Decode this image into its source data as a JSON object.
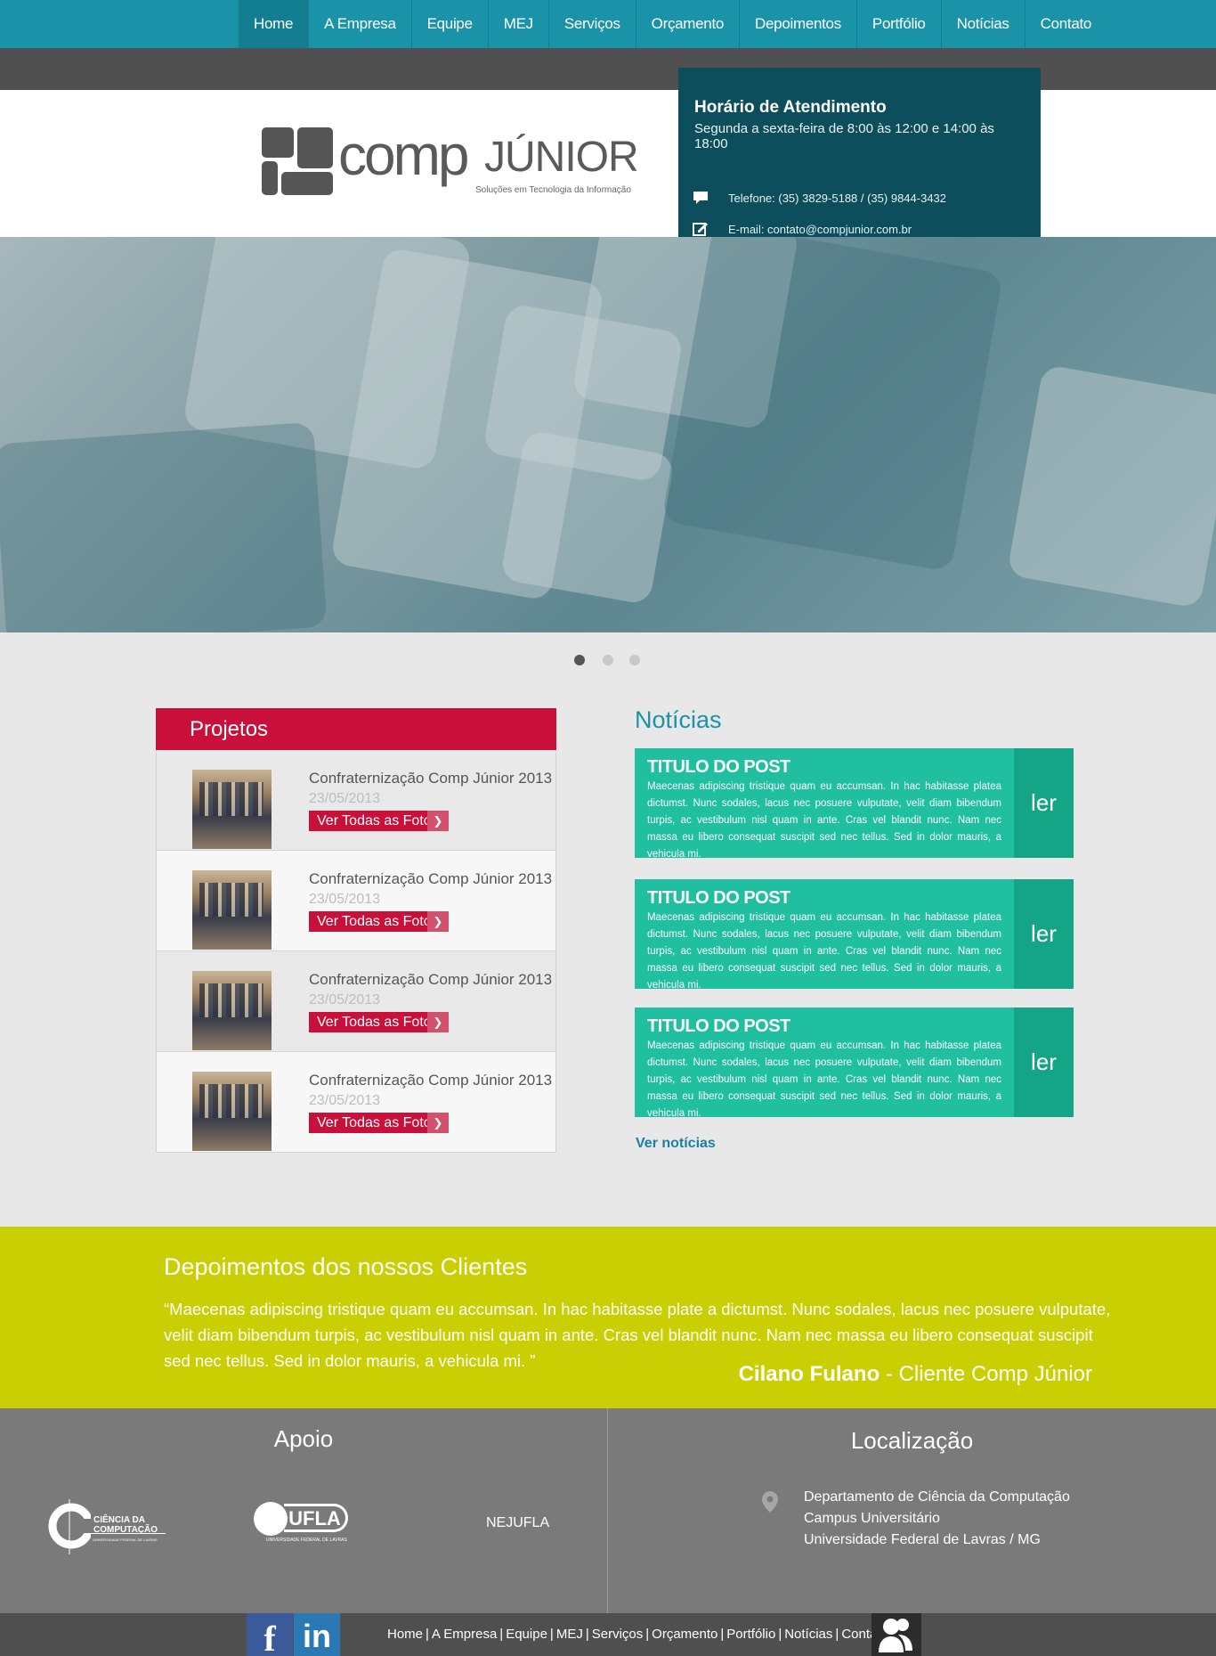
{
  "nav": {
    "items": [
      "Home",
      "A Empresa",
      "Equipe",
      "MEJ",
      "Serviços",
      "Orçamento",
      "Depoimentos",
      "Portfólio",
      "Notícias",
      "Contato"
    ],
    "active": "Home"
  },
  "logo": {
    "word": "comp",
    "word2": "JÚNIOR",
    "tagline": "Soluções em Tecnologia da Informação"
  },
  "info": {
    "title": "Horário de Atendimento",
    "hours": "Segunda a sexta-feira de 8:00 às 12:00 e 14:00 às 18:00",
    "phone": "Telefone: (35) 3829-5188 / (35) 9844-3432",
    "email": "E-mail: contato@compjunior.com.br"
  },
  "slider": {
    "count": 3,
    "active": 1
  },
  "projetos": {
    "title": "Projetos",
    "items": [
      {
        "title": "Confraternização Comp Júnior 2013",
        "date": "23/05/2013",
        "button": "Ver Todas as Fotos"
      },
      {
        "title": "Confraternização Comp Júnior 2013",
        "date": "23/05/2013",
        "button": "Ver Todas as Fotos"
      },
      {
        "title": "Confraternização Comp Júnior 2013",
        "date": "23/05/2013",
        "button": "Ver Todas as Fotos"
      },
      {
        "title": "Confraternização Comp Júnior 2013",
        "date": "23/05/2013",
        "button": "Ver Todas as Fotos"
      }
    ]
  },
  "noticias": {
    "title": "Notícias",
    "posts": [
      {
        "title": "TITULO DO POST",
        "text": "Maecenas adipiscing tristique quam eu accumsan. In hac habitasse platea dictumst. Nunc sodales, lacus nec posuere vulputate, velit diam bibendum turpis, ac vestibulum nisl quam in ante. Cras vel blandit nunc. Nam nec massa eu libero consequat suscipit sed nec tellus. Sed in dolor mauris, a vehicula mi.",
        "read": "ler"
      },
      {
        "title": "TITULO DO POST",
        "text": "Maecenas adipiscing tristique quam eu accumsan. In hac habitasse platea dictumst. Nunc sodales, lacus nec posuere vulputate, velit diam bibendum turpis, ac vestibulum nisl quam in ante. Cras vel blandit nunc. Nam nec massa eu libero consequat suscipit sed nec tellus. Sed in dolor mauris, a vehicula mi.",
        "read": "ler"
      },
      {
        "title": "TITULO DO POST",
        "text": "Maecenas adipiscing tristique quam eu accumsan. In hac habitasse platea dictumst. Nunc sodales, lacus nec posuere vulputate, velit diam bibendum turpis, ac vestibulum nisl quam in ante. Cras vel blandit nunc. Nam nec massa eu libero consequat suscipit sed nec tellus. Sed in dolor mauris, a vehicula mi.",
        "read": "ler"
      }
    ],
    "more": "Ver notícias"
  },
  "depoimentos": {
    "title": "Depoimentos dos nossos Clientes",
    "quote": "“Maecenas adipiscing tristique quam eu accumsan. In hac habitasse plate a dictumst. Nunc sodales, lacus nec posuere vulputate, velit diam bibendum turpis, ac vestibulum nisl quam in ante. Cras vel blandit nunc. Nam nec massa eu libero consequat suscipit sed nec tellus. Sed in dolor mauris, a vehicula mi. ”",
    "author_name": "Cilano Fulano",
    "author_role": " - Cliente Comp Júnior"
  },
  "footer": {
    "apoio_title": "Apoio",
    "logo1_line1": "CIÊNCIA DA",
    "logo1_line2": "COMPUTAÇÃO",
    "logo1_line3": "UNIVERSIDADE FEDERAL DE LAVRAS",
    "logo2_text": "UFLA",
    "logo2_sub": "UNIVERSIDADE FEDERAL DE LAVRAS",
    "nejufla": "NEJUFLA",
    "local_title": "Localização",
    "address": [
      "Departamento de Ciência da Computação",
      "Campus Universitário",
      "Universidade Federal de Lavras / MG"
    ]
  },
  "bottom": {
    "fb": "f",
    "li": "in",
    "links": [
      "Home",
      "A Empresa",
      "Equipe",
      "MEJ",
      "Serviços",
      "Orçamento",
      "Portfólio",
      "Notícias",
      "Contato"
    ]
  },
  "colors": {
    "nav": "#1a93a8",
    "red": "#c8103a",
    "green": "#1fbf9f",
    "lime": "#c9cf02"
  }
}
